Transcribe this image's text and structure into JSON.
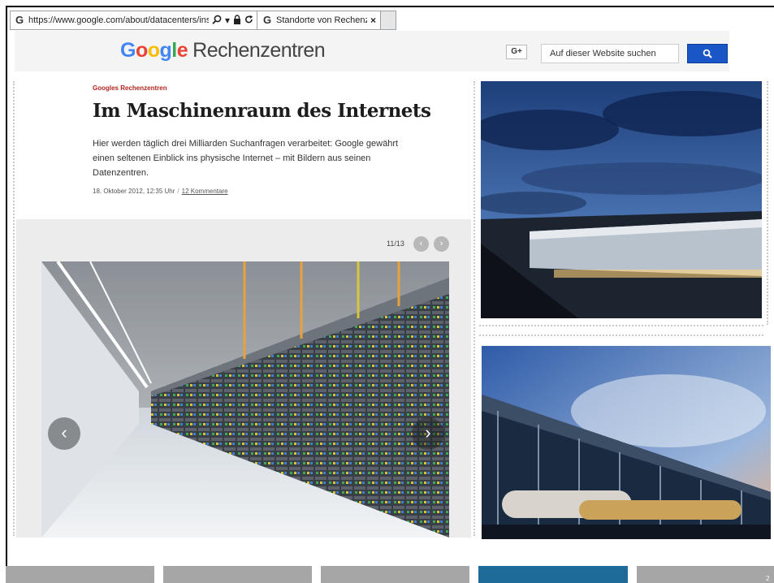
{
  "browser": {
    "url": "https://www.google.com/about/datacenters/inside/lc",
    "tab_title": "Standorte von Rechenzentr...",
    "tab_close": "×"
  },
  "site": {
    "logo_google": [
      "G",
      "o",
      "o",
      "g",
      "l",
      "e"
    ],
    "logo_colors": [
      "#4285f4",
      "#ea4335",
      "#fbbc05",
      "#4285f4",
      "#34a853",
      "#ea4335"
    ],
    "logo_sub": "Rechenzentren",
    "gplus_label": "G+",
    "search_placeholder": "Auf dieser Website suchen",
    "accent": "#1a56c6"
  },
  "article": {
    "kicker": "Googles Rechenzentren",
    "headline": "Im Maschinenraum des Internets",
    "lead": "Hier werden täglich drei Milliarden Suchanfragen verarbeitet: Google gewährt einen seltenen Einblick ins physische Internet – mit Bildern aus seinen Datenzentren.",
    "date": "18. Oktober 2012, 12:35 Uhr",
    "comments": "12 Kommentare"
  },
  "gallery": {
    "counter": "11/13",
    "prev": "‹",
    "next": "›"
  },
  "slide": {
    "page_number": "2",
    "bottom_bar_colors": [
      "#a6a6a6",
      "#a6a6a6",
      "#a6a6a6",
      "#1e6b9a",
      "#a6a6a6"
    ]
  }
}
